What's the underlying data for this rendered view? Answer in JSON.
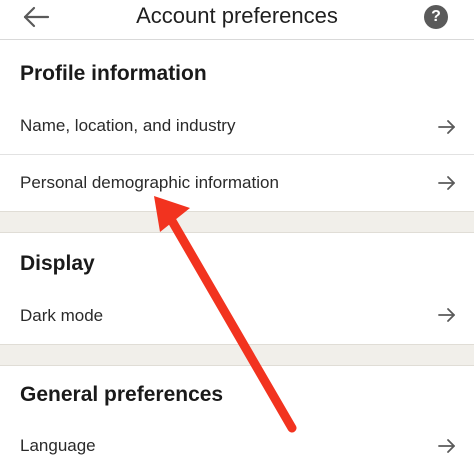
{
  "header": {
    "title": "Account preferences",
    "help_glyph": "?",
    "back_icon": "arrow-left-icon",
    "help_icon": "question-circle-icon"
  },
  "sections": [
    {
      "title": "Profile information",
      "items": [
        {
          "label": "Name, location, and industry"
        },
        {
          "label": "Personal demographic information"
        }
      ]
    },
    {
      "title": "Display",
      "items": [
        {
          "label": "Dark mode"
        }
      ]
    },
    {
      "title": "General preferences",
      "items": [
        {
          "label": "Language"
        }
      ]
    }
  ],
  "colors": {
    "annotation_arrow": "#f2331f",
    "section_gap": "#f1efea"
  }
}
